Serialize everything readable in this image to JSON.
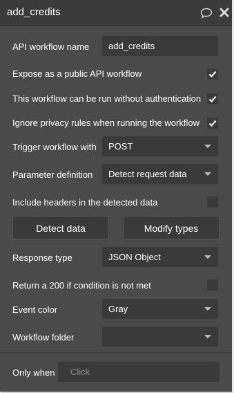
{
  "header": {
    "title": "add_credits"
  },
  "icons": {
    "comment": "speech-bubble-icon",
    "close": "close-x-icon"
  },
  "fields": {
    "workflow_name_label": "API workflow name",
    "workflow_name_value": "add_credits",
    "expose_label": "Expose as a public API workflow",
    "no_auth_label": "This workflow can be run without authentication",
    "ignore_privacy_label": "Ignore privacy rules when running the workflow",
    "trigger_label": "Trigger workflow with",
    "trigger_value": "POST",
    "param_def_label": "Parameter definition",
    "param_def_value": "Detect request data",
    "include_headers_label": "Include headers in the detected data",
    "response_type_label": "Response type",
    "response_type_value": "JSON Object",
    "return_200_label": "Return a 200 if condition is not met",
    "event_color_label": "Event color",
    "event_color_value": "Gray",
    "workflow_folder_label": "Workflow folder",
    "workflow_folder_value": ""
  },
  "buttons": {
    "detect": "Detect data",
    "modify": "Modify types"
  },
  "only_when": {
    "label": "Only when",
    "placeholder": "Click"
  },
  "checkboxes": {
    "expose": true,
    "no_auth": true,
    "ignore_privacy": true,
    "include_headers": false,
    "return_200": false
  },
  "colors": {
    "panel": "#4a4a4a",
    "header": "#3b3b3b",
    "field": "#3a3a3a"
  }
}
